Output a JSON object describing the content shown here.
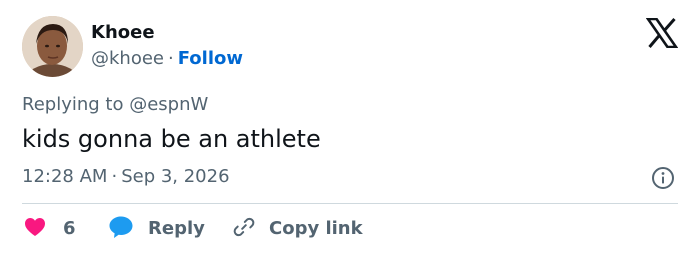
{
  "author": {
    "name": "Khoee",
    "handle": "@khoee",
    "separator": "·",
    "follow_label": "Follow",
    "avatar_icon": "profile-photo"
  },
  "tweet": {
    "replying_to": "Replying to @espnW",
    "text": "kids gonna be an athlete",
    "time": "12:28 AM",
    "separator": "·",
    "date": "Sep 3, 2026"
  },
  "actions": {
    "like_count": "6",
    "reply_label": "Reply",
    "copy_label": "Copy link"
  },
  "icons": {
    "brand": "x-logo-icon",
    "info": "info-icon",
    "like": "heart-icon",
    "reply": "speech-bubble-icon",
    "copy": "link-icon"
  },
  "colors": {
    "like": "#f91880",
    "reply": "#1d9bf0",
    "follow": "#0068d2",
    "muted": "#536471",
    "text": "#0f1419",
    "divider": "#cfd9de"
  }
}
